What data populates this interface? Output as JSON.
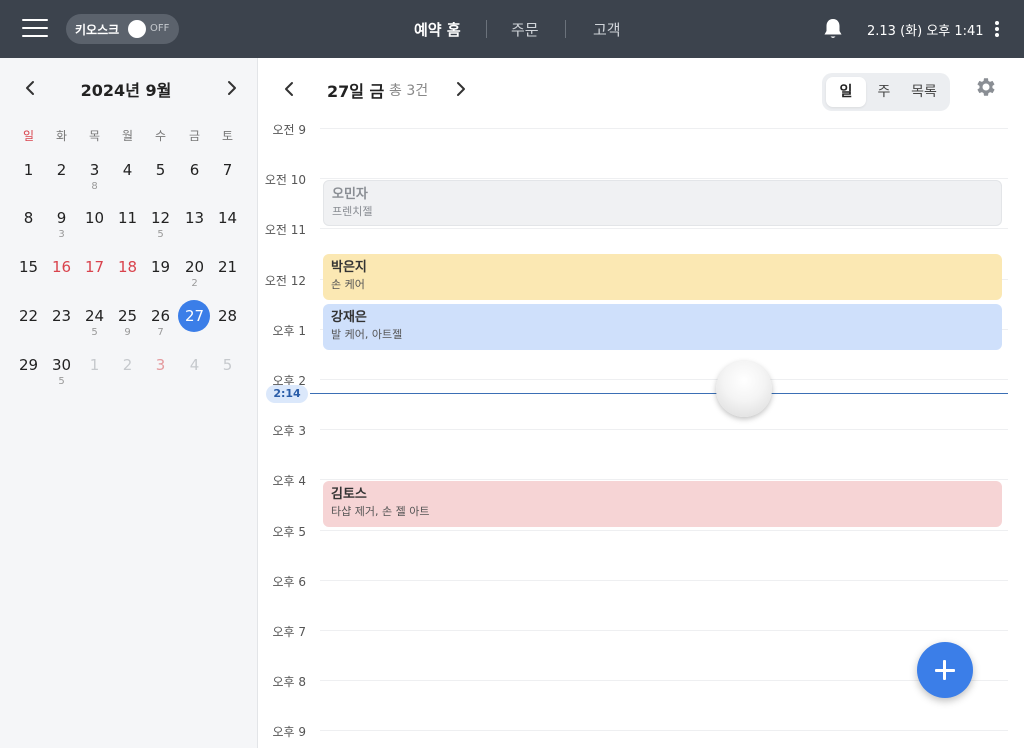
{
  "topbar": {
    "kiosk_label": "키오스크",
    "kiosk_state": "OFF",
    "nav": [
      "예약 홈",
      "주문",
      "고객"
    ],
    "datetime": "2.13 (화) 오후 1:41"
  },
  "calendar": {
    "title": "2024년 9월",
    "weekdays": [
      "일",
      "화",
      "목",
      "월",
      "수",
      "금",
      "토"
    ],
    "weeks": [
      [
        {
          "d": "1",
          "c": ""
        },
        {
          "d": "2",
          "c": ""
        },
        {
          "d": "3",
          "c": "8"
        },
        {
          "d": "4",
          "c": ""
        },
        {
          "d": "5",
          "c": ""
        },
        {
          "d": "6",
          "c": ""
        },
        {
          "d": "7",
          "c": ""
        }
      ],
      [
        {
          "d": "8",
          "c": ""
        },
        {
          "d": "9",
          "c": "3"
        },
        {
          "d": "10",
          "c": ""
        },
        {
          "d": "11",
          "c": ""
        },
        {
          "d": "12",
          "c": "5"
        },
        {
          "d": "13",
          "c": ""
        },
        {
          "d": "14",
          "c": ""
        }
      ],
      [
        {
          "d": "15",
          "c": ""
        },
        {
          "d": "16",
          "c": ""
        },
        {
          "d": "17",
          "c": ""
        },
        {
          "d": "18",
          "c": ""
        },
        {
          "d": "19",
          "c": ""
        },
        {
          "d": "20",
          "c": "2"
        },
        {
          "d": "21",
          "c": ""
        }
      ],
      [
        {
          "d": "22",
          "c": ""
        },
        {
          "d": "23",
          "c": ""
        },
        {
          "d": "24",
          "c": "5"
        },
        {
          "d": "25",
          "c": "9"
        },
        {
          "d": "26",
          "c": "7"
        },
        {
          "d": "27",
          "c": ""
        },
        {
          "d": "28",
          "c": ""
        }
      ],
      [
        {
          "d": "29",
          "c": ""
        },
        {
          "d": "30",
          "c": "5"
        },
        {
          "d": "1",
          "c": ""
        },
        {
          "d": "2",
          "c": ""
        },
        {
          "d": "3",
          "c": ""
        },
        {
          "d": "4",
          "c": ""
        },
        {
          "d": "5",
          "c": ""
        }
      ]
    ],
    "selected": "27",
    "colors": {
      "holiday": "#d9434d",
      "selected": "#3b7ee8"
    }
  },
  "dayview": {
    "title": "27일 금",
    "count": "총 3건",
    "view_tabs": [
      "일",
      "주",
      "목록"
    ],
    "hours": [
      "오전 9",
      "오전 10",
      "오전 11",
      "오전 12",
      "오후 1",
      "오후 2",
      "오후 3",
      "오후 4",
      "오후 5",
      "오후 6",
      "오후 7",
      "오후 8",
      "오후 9"
    ],
    "now": "2:14",
    "events": [
      {
        "name": "오민자",
        "services": "프렌치젤",
        "color": "#f0f1f3"
      },
      {
        "name": "박은지",
        "services": "손 케어",
        "color": "#fbe8b3"
      },
      {
        "name": "강재은",
        "services": "발 케어, 아트젤",
        "color": "#cfe0fb"
      },
      {
        "name": "김토스",
        "services": "타샵 제거, 손 젤 아트",
        "color": "#f6d4d5"
      }
    ]
  }
}
